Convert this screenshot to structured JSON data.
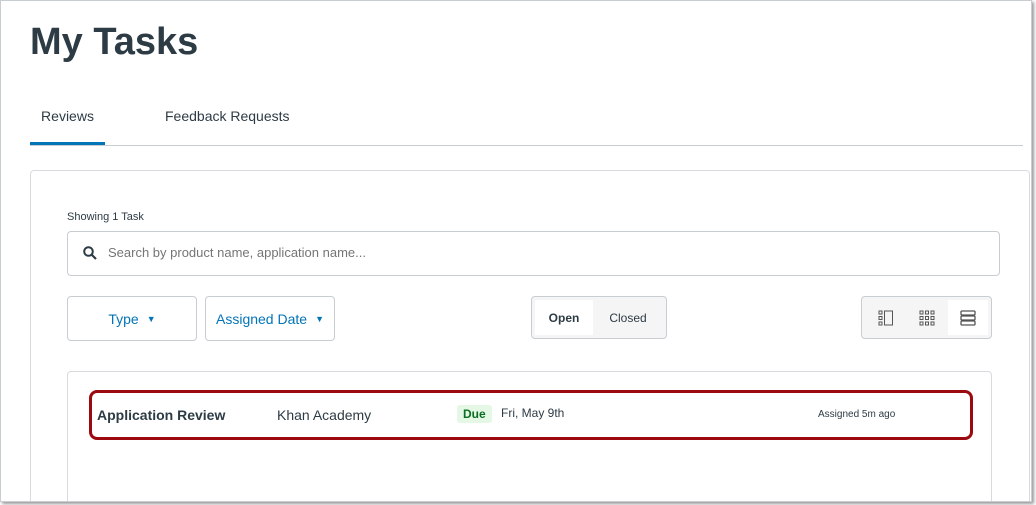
{
  "page": {
    "title": "My Tasks"
  },
  "tabs": [
    {
      "label": "Reviews"
    },
    {
      "label": "Feedback Requests"
    }
  ],
  "list": {
    "showing": "Showing 1 Task",
    "search_placeholder": "Search by product name, application name..."
  },
  "filters": {
    "type": "Type",
    "assigned_date": "Assigned Date"
  },
  "status": {
    "open": "Open",
    "closed": "Closed"
  },
  "views": [
    "sidebar-view-icon",
    "grid-view-icon",
    "list-view-icon"
  ],
  "tasks": [
    {
      "title": "Application Review",
      "org": "Khan Academy",
      "badge": "Due",
      "date": "Fri, May 9th",
      "assigned": "Assigned 5m ago"
    }
  ]
}
